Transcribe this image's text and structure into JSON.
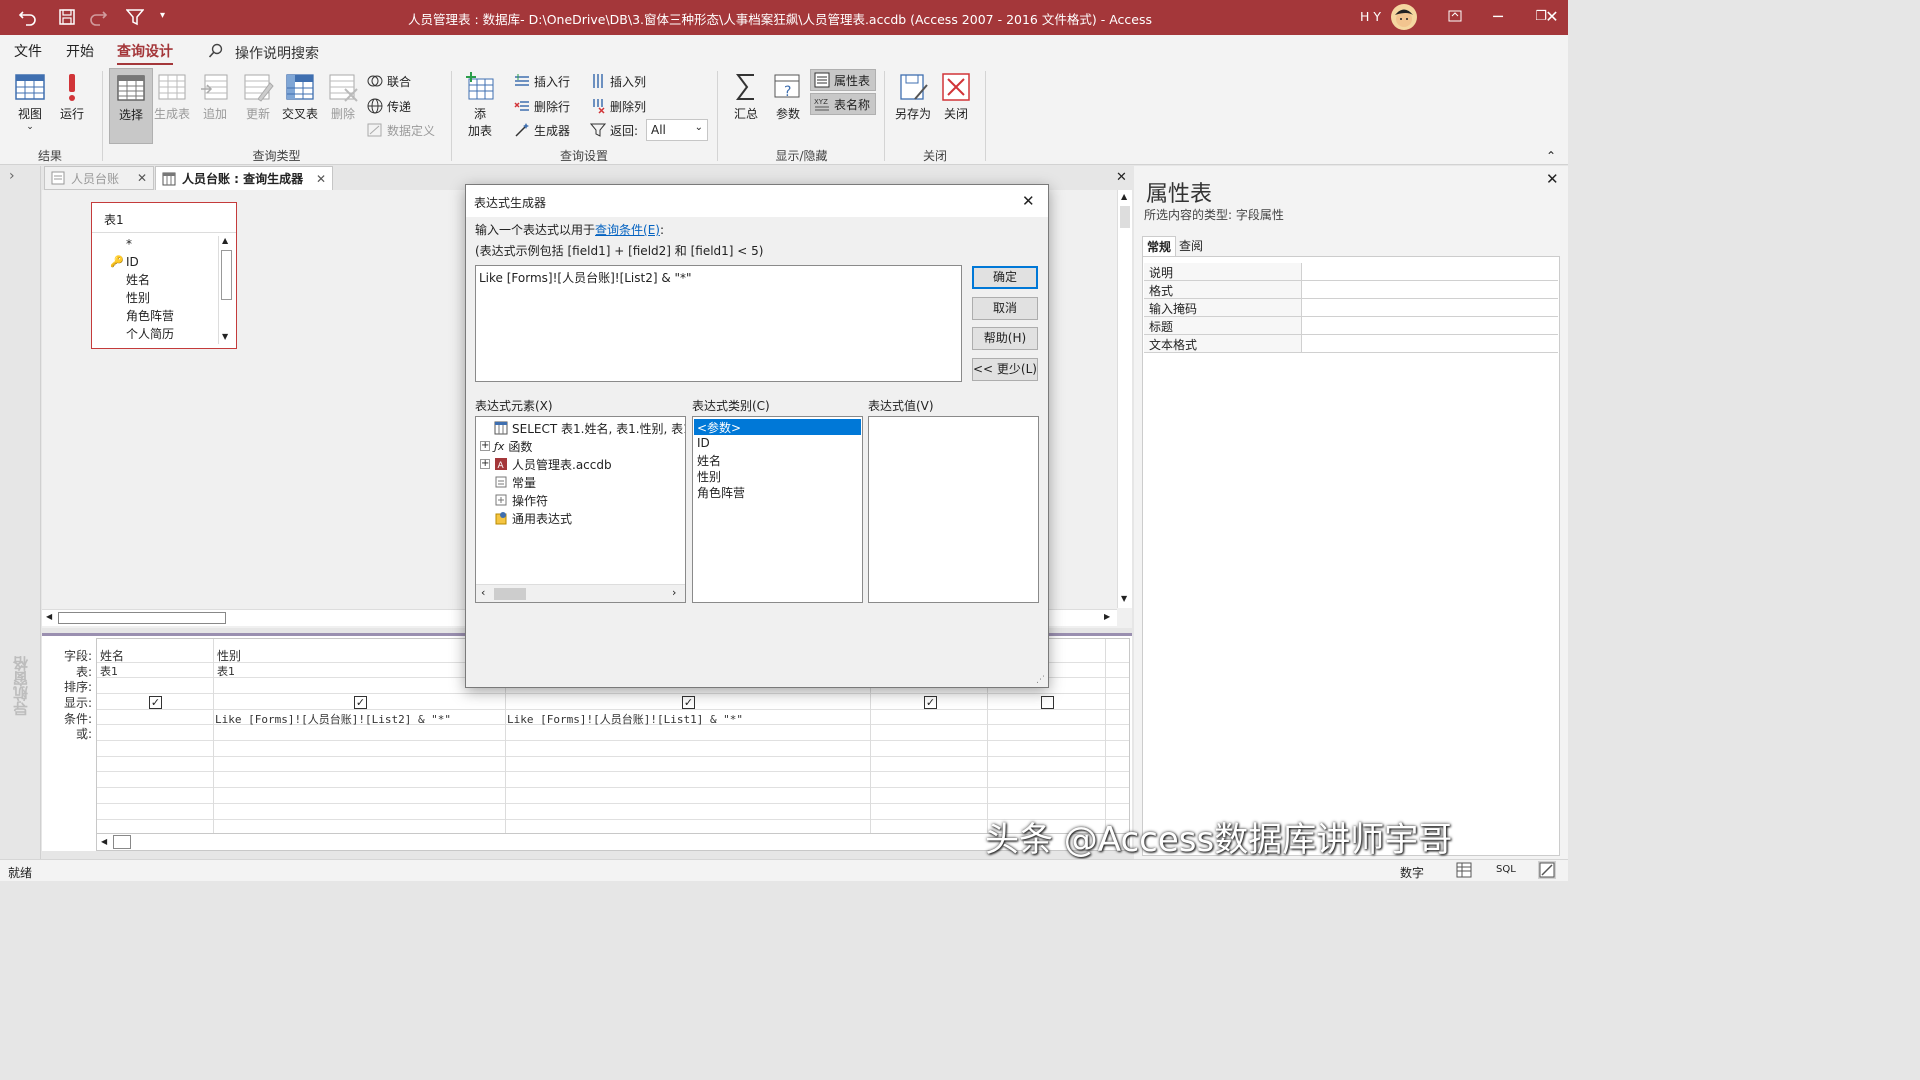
{
  "titlebar": {
    "title": "人员管理表 : 数据库- D:\\OneDrive\\DB\\3.窗体三种形态\\人事档案狂飙\\人员管理表.accdb (Access 2007 - 2016 文件格式)  -  Access",
    "user": "H Y"
  },
  "ribbon_tabs": [
    "文件",
    "开始",
    "查询设计"
  ],
  "tell_me": "操作说明搜索",
  "ribbon": {
    "view": "视图",
    "run": "运行",
    "results_group": "结果",
    "select": "选择",
    "make_table": "生成表",
    "append": "追加",
    "update": "更新",
    "crosstab": "交叉表",
    "delete": "删除",
    "union": "联合",
    "passthrough": "传递",
    "data_definition": "数据定义",
    "query_type_group": "查询类型",
    "add_table_1": "添",
    "add_table_2": "加表",
    "insert_rows": "插入行",
    "delete_rows": "删除行",
    "builder": "生成器",
    "insert_cols": "插入列",
    "delete_cols": "删除列",
    "return_label": "返回:",
    "return_value": "All",
    "query_setup_group": "查询设置",
    "totals": "汇总",
    "parameters": "参数",
    "property_sheet": "属性表",
    "table_names": "表名称",
    "show_hide_group": "显示/隐藏",
    "save_as": "另存为",
    "close": "关闭",
    "close_group": "关闭"
  },
  "doc_tabs": [
    "人员台账",
    "人员台账 : 查询生成器"
  ],
  "nav_pane_label": "导航窗格",
  "field_list": {
    "title": "表1",
    "fields": [
      "*",
      "ID",
      "姓名",
      "性别",
      "角色阵营",
      "个人简历"
    ]
  },
  "grid": {
    "row_labels": [
      "字段:",
      "表:",
      "排序:",
      "显示:",
      "条件:",
      "或:"
    ],
    "col1": {
      "field": "姓名",
      "table": "表1",
      "show": true,
      "criteria": ""
    },
    "col2": {
      "field": "性别",
      "table": "表1",
      "show": true,
      "criteria": "Like [Forms]![人员台账]![List2] & \"*\""
    },
    "col3": {
      "field": "",
      "table": "",
      "show": true,
      "criteria": "Like [Forms]![人员台账]![List1] & \"*\""
    },
    "col4": {
      "show": true
    },
    "col5": {
      "show": false
    }
  },
  "property_sheet": {
    "title": "属性表",
    "selection_type": "所选内容的类型:  字段属性",
    "tabs": [
      "常规",
      "查阅"
    ],
    "rows": [
      "说明",
      "格式",
      "输入掩码",
      "标题",
      "文本格式"
    ]
  },
  "dialog": {
    "title": "表达式生成器",
    "prompt_prefix": "输入一个表达式以用于",
    "prompt_link": "查询条件(E)",
    "prompt_suffix": ":",
    "example": "(表达式示例包括 [field1] + [field2] 和 [field1] < 5)",
    "expression": "Like [Forms]![人员台账]![List2] & \"*\"",
    "ok": "确定",
    "cancel": "取消",
    "help": "帮助(H)",
    "less": "<< 更少(L)",
    "elements_label": "表达式元素(X)",
    "categories_label": "表达式类别(C)",
    "values_label": "表达式值(V)",
    "elements": [
      "SELECT 表1.姓名, 表1.性别, 表1",
      "函数",
      "人员管理表.accdb",
      "常量",
      "操作符",
      "通用表达式"
    ],
    "categories": [
      "<参数>",
      "ID",
      "姓名",
      "性别",
      "角色阵营"
    ]
  },
  "status": {
    "left": "就绪",
    "mode": "数字",
    "sql": "SQL"
  },
  "watermark": "头条 @Access数据库讲师宇哥"
}
